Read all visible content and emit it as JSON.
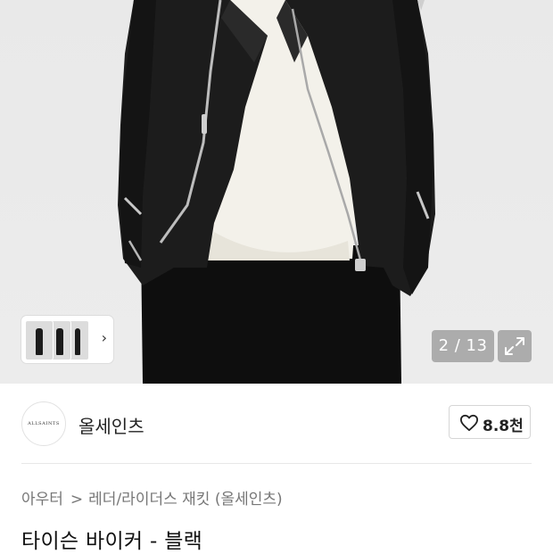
{
  "gallery": {
    "counter": "2 / 13",
    "thumbnail_count": 3,
    "thumbnail_chevron": "›",
    "expand_icon": "expand-icon"
  },
  "brand": {
    "logo_text": "ALLSAINTS",
    "name": "올세인츠",
    "likes": "8.8천",
    "like_icon": "heart-icon"
  },
  "breadcrumb": {
    "category": "아우터",
    "separator": ">",
    "subcategory": "레더/라이더스 재킷 (올세인츠)"
  },
  "product": {
    "title": "타이슨 바이커 - 블랙"
  },
  "colors": {
    "background": "#ffffff",
    "photo_bg": "#eaeaea",
    "jacket": "#1c1c1c",
    "sweater": "#f3f1ea",
    "muted_text": "#777777"
  }
}
